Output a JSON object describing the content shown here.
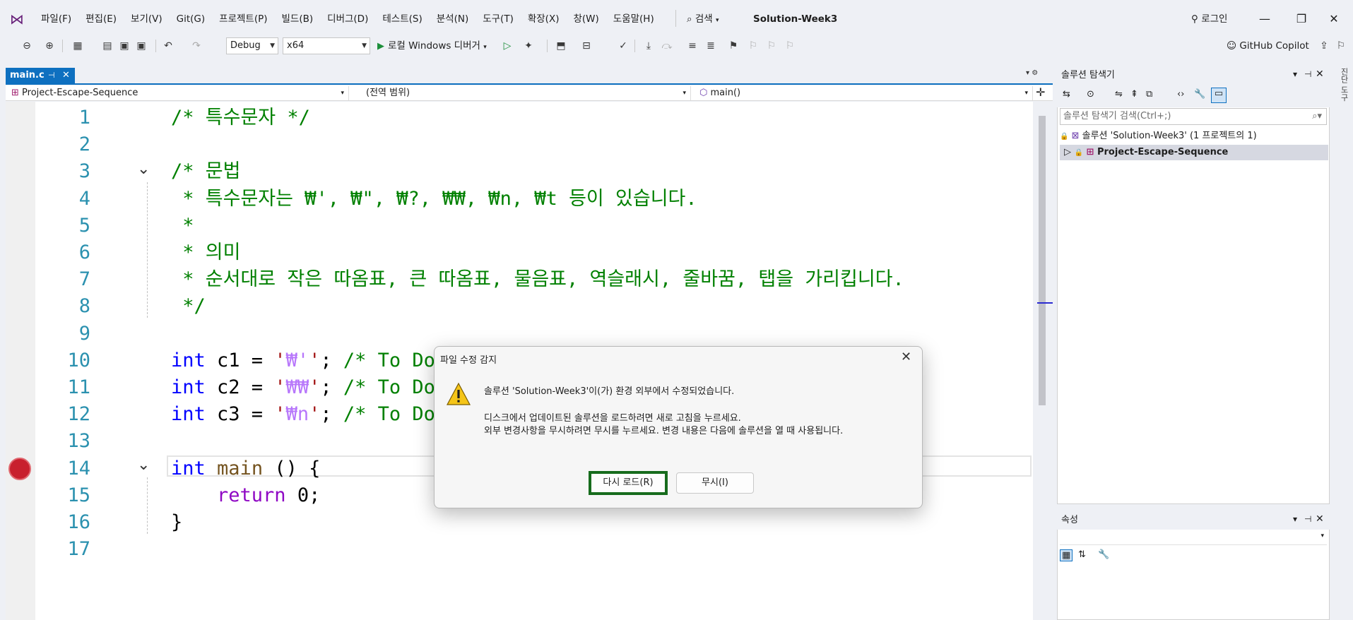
{
  "menu": {
    "items": [
      "파일(F)",
      "편집(E)",
      "보기(V)",
      "Git(G)",
      "프로젝트(P)",
      "빌드(B)",
      "디버그(D)",
      "테스트(S)",
      "분석(N)",
      "도구(T)",
      "확장(X)",
      "창(W)",
      "도움말(H)"
    ],
    "search_label": "검색",
    "solution_name": "Solution-Week3",
    "login_label": "로그인"
  },
  "toolbar": {
    "config": "Debug",
    "platform": "x64",
    "run_label": "로컬 Windows 디버거",
    "copilot_label": "GitHub Copilot"
  },
  "editor": {
    "tab_label": "main.c",
    "nav_project": "Project-Escape-Sequence",
    "nav_scope": "(전역 범위)",
    "nav_function": "main()",
    "lines": [
      {
        "n": "1",
        "segs": [
          {
            "t": "/* 특수문자 */",
            "c": "cm"
          }
        ]
      },
      {
        "n": "2",
        "segs": []
      },
      {
        "n": "3",
        "segs": [
          {
            "t": "/* 문법",
            "c": "cm"
          }
        ]
      },
      {
        "n": "4",
        "segs": [
          {
            "t": " * 특수문자는 ₩', ₩\", ₩?, ₩₩, ₩n, ₩t 등이 있습니다.",
            "c": "cm"
          }
        ]
      },
      {
        "n": "5",
        "segs": [
          {
            "t": " *",
            "c": "cm"
          }
        ]
      },
      {
        "n": "6",
        "segs": [
          {
            "t": " * 의미",
            "c": "cm"
          }
        ]
      },
      {
        "n": "7",
        "segs": [
          {
            "t": " * 순서대로 작은 따옴표, 큰 따옴표, 물음표, 역슬래시, 줄바꿈, 탭을 가리킵니다.",
            "c": "cm"
          }
        ]
      },
      {
        "n": "8",
        "segs": [
          {
            "t": " */",
            "c": "cm"
          }
        ]
      },
      {
        "n": "9",
        "segs": []
      },
      {
        "n": "10",
        "segs": [
          {
            "t": "int",
            "c": "kw"
          },
          {
            "t": " c1 = ",
            "c": "tx"
          },
          {
            "t": "'",
            "c": "str"
          },
          {
            "t": "₩'",
            "c": "esc"
          },
          {
            "t": "'",
            "c": "str"
          },
          {
            "t": "; ",
            "c": "tx"
          },
          {
            "t": "/* To Do: 변수 c1을 작은 따옴표로 설정해보",
            "c": "cm"
          }
        ]
      },
      {
        "n": "11",
        "segs": [
          {
            "t": "int",
            "c": "kw"
          },
          {
            "t": " c2 = ",
            "c": "tx"
          },
          {
            "t": "'",
            "c": "str"
          },
          {
            "t": "₩₩",
            "c": "esc"
          },
          {
            "t": "'",
            "c": "str"
          },
          {
            "t": "; ",
            "c": "tx"
          },
          {
            "t": "/* To Do: 변수 c2를 역슬래시로 설정해보",
            "c": "cm"
          }
        ]
      },
      {
        "n": "12",
        "segs": [
          {
            "t": "int",
            "c": "kw"
          },
          {
            "t": " c3 = ",
            "c": "tx"
          },
          {
            "t": "'",
            "c": "str"
          },
          {
            "t": "₩n",
            "c": "esc"
          },
          {
            "t": "'",
            "c": "str"
          },
          {
            "t": "; ",
            "c": "tx"
          },
          {
            "t": "/* To Do: 변수 c3을 줄바꿈으로 설정해보",
            "c": "cm"
          }
        ]
      },
      {
        "n": "13",
        "segs": []
      },
      {
        "n": "14",
        "segs": [
          {
            "t": "int",
            "c": "kw"
          },
          {
            "t": " ",
            "c": "tx"
          },
          {
            "t": "main",
            "c": "fn"
          },
          {
            "t": " () {",
            "c": "tx"
          }
        ]
      },
      {
        "n": "15",
        "segs": [
          {
            "t": "    ",
            "c": "tx"
          },
          {
            "t": "return",
            "c": "kw2"
          },
          {
            "t": " 0;",
            "c": "tx"
          }
        ]
      },
      {
        "n": "16",
        "segs": [
          {
            "t": "}",
            "c": "tx"
          }
        ]
      },
      {
        "n": "17",
        "segs": []
      }
    ]
  },
  "solution_explorer": {
    "title": "솔루션 탐색기",
    "search_placeholder": "솔루션 탐색기 검색(Ctrl+;)",
    "root_label": "솔루션 'Solution-Week3' (1 프로젝트의 1)",
    "project_label": "Project-Escape-Sequence"
  },
  "properties": {
    "title": "속성"
  },
  "side_label": "진단 도구",
  "dialog": {
    "title": "파일 수정 감지",
    "line1": "솔루션 'Solution-Week3'이(가) 환경 외부에서 수정되었습니다.",
    "line2": "디스크에서 업데이트된 솔루션을 로드하려면 새로 고침을 누르세요.",
    "line3": "외부 변경사항을 무시하려면 무시를 누르세요. 변경 내용은 다음에 솔루션을 열 때 사용됩니다.",
    "reload_label": "다시 로드(R)",
    "ignore_label": "무시(I)"
  },
  "colors": {
    "accent": "#0e70c0",
    "comment": "#008000",
    "keyword": "#0000ff",
    "breakpoint": "#c8202e",
    "reload_border": "#176c1d"
  }
}
